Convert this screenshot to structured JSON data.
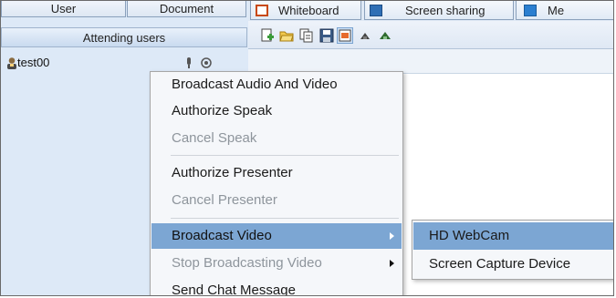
{
  "left_panel": {
    "tabs": [
      {
        "label": "User"
      },
      {
        "label": "Document"
      }
    ],
    "section_header": "Attending users",
    "users": [
      {
        "name": "test00"
      }
    ]
  },
  "right_panel": {
    "tabs": [
      {
        "label": "Whiteboard",
        "icon": "whiteboard-icon"
      },
      {
        "label": "Screen sharing",
        "icon": "screen-sharing-icon"
      },
      {
        "label": "Me",
        "icon": "media-icon"
      }
    ],
    "toolbar": [
      {
        "icon": "new-page-icon"
      },
      {
        "icon": "open-folder-icon"
      },
      {
        "icon": "copy-icon"
      },
      {
        "icon": "save-icon"
      },
      {
        "icon": "image-icon"
      },
      {
        "icon": "move-up-icon"
      },
      {
        "icon": "move-down-icon"
      }
    ]
  },
  "context_menu": {
    "items": [
      {
        "label": "Broadcast Audio And Video",
        "enabled": true
      },
      {
        "label": "Authorize Speak",
        "enabled": true
      },
      {
        "label": "Cancel Speak",
        "enabled": false
      },
      {
        "label": "Authorize Presenter",
        "enabled": true
      },
      {
        "label": "Cancel Presenter",
        "enabled": false
      },
      {
        "label": "Broadcast Video",
        "enabled": true,
        "highlighted": true,
        "has_submenu": true
      },
      {
        "label": "Stop Broadcasting Video",
        "enabled": false,
        "has_submenu": true
      },
      {
        "label": "Send Chat Message",
        "enabled": true
      }
    ]
  },
  "submenu": {
    "items": [
      {
        "label": "HD WebCam",
        "highlighted": true
      },
      {
        "label": "Screen Capture Device",
        "highlighted": false
      }
    ]
  },
  "colors": {
    "highlight": "#7ca6d3",
    "panel_bg": "#dde9f7",
    "disabled_text": "#8e959c"
  }
}
